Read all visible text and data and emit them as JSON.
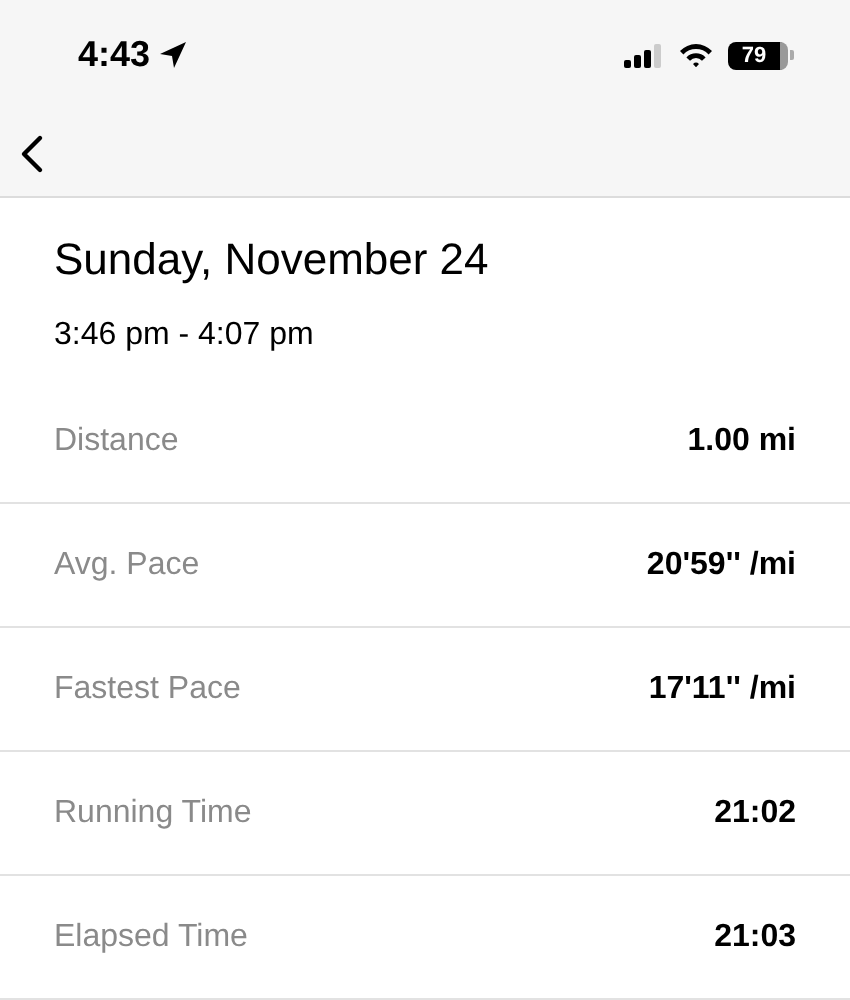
{
  "status_bar": {
    "time": "4:43",
    "battery": "79"
  },
  "header": {
    "title": "Sunday, November 24",
    "time_range": "3:46 pm - 4:07 pm"
  },
  "stats": [
    {
      "label": "Distance",
      "value": "1.00 mi"
    },
    {
      "label": "Avg. Pace",
      "value": "20'59'' /mi"
    },
    {
      "label": "Fastest Pace",
      "value": "17'11'' /mi"
    },
    {
      "label": "Running Time",
      "value": "21:02"
    },
    {
      "label": "Elapsed Time",
      "value": "21:03"
    }
  ]
}
